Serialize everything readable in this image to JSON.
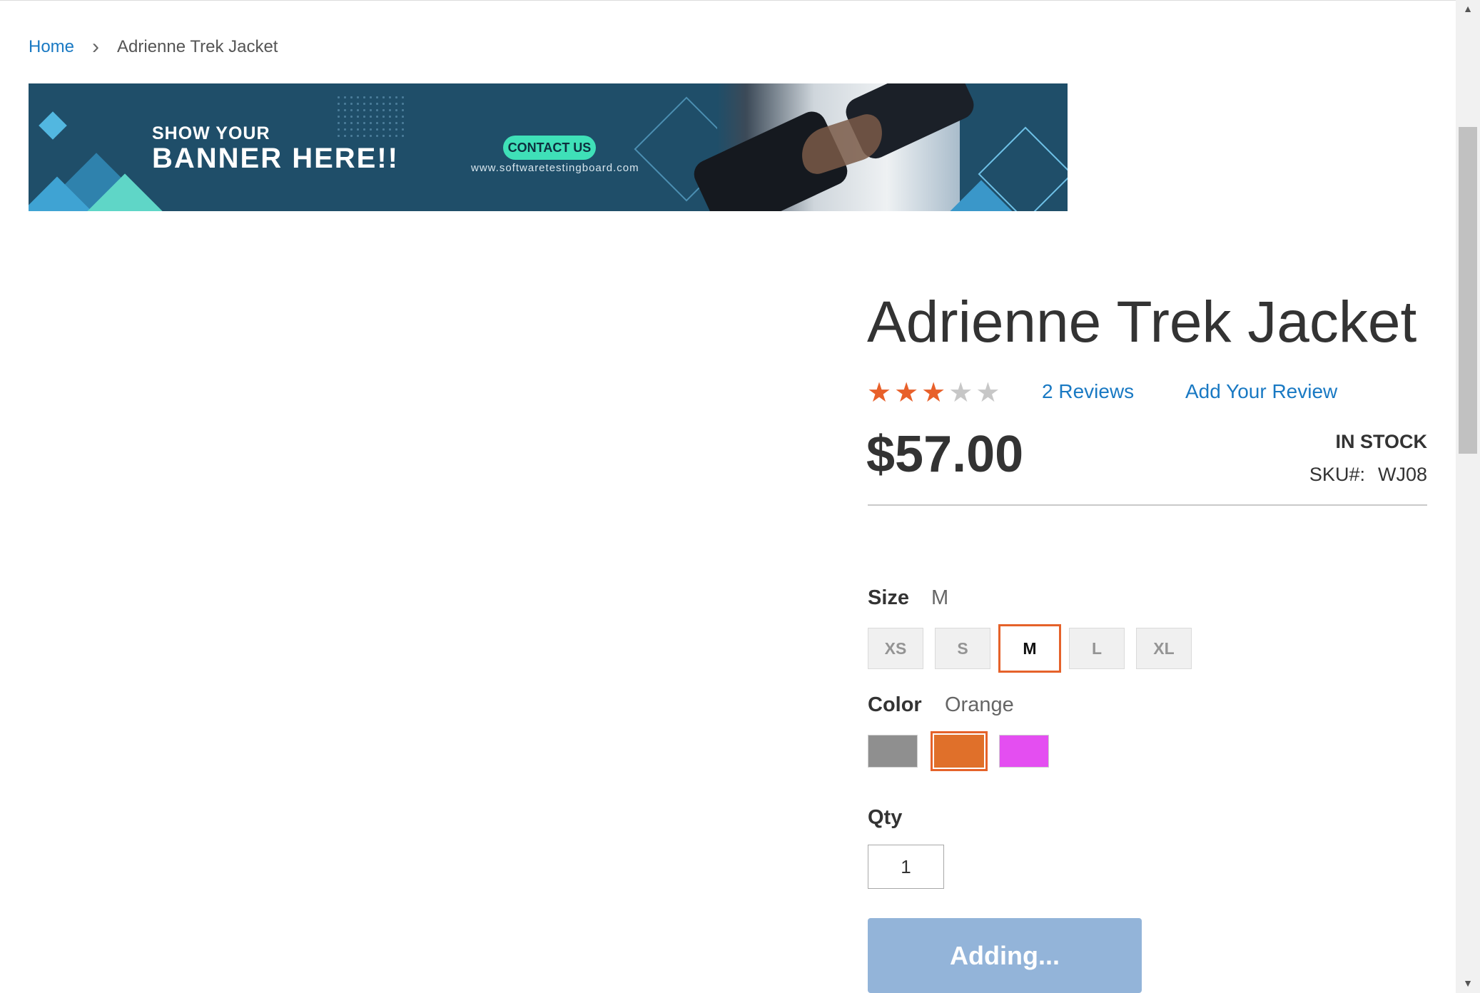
{
  "breadcrumb": {
    "home": "Home",
    "separator": "›",
    "current": "Adrienne Trek Jacket"
  },
  "banner": {
    "tagline": "SHOW YOUR",
    "headline": "BANNER HERE!!",
    "cta_label": "CONTACT US",
    "url": "www.softwaretestingboard.com"
  },
  "product": {
    "name": "Adrienne Trek Jacket",
    "rating_stars": 3,
    "rating_max": 5,
    "reviews_link": "2  Reviews",
    "add_review_link": "Add Your Review",
    "price": "$57.00",
    "stock_status": "IN STOCK",
    "sku_label": "SKU#:",
    "sku_value": "WJ08"
  },
  "options": {
    "size": {
      "label": "Size",
      "selected": "M",
      "choices": [
        "XS",
        "S",
        "M",
        "L",
        "XL"
      ]
    },
    "color": {
      "label": "Color",
      "selected": "Orange",
      "choices": [
        {
          "name": "Gray",
          "hex": "#8f8f8f"
        },
        {
          "name": "Orange",
          "hex": "#e0702a"
        },
        {
          "name": "Purple",
          "hex": "#e44ef1"
        }
      ]
    }
  },
  "qty": {
    "label": "Qty",
    "value": "1"
  },
  "add_button": {
    "label": "Adding..."
  },
  "colors": {
    "link": "#1979c3",
    "star_on": "#e8602a",
    "selected_border": "#e5622a",
    "button_disabled": "#93b4d9"
  }
}
